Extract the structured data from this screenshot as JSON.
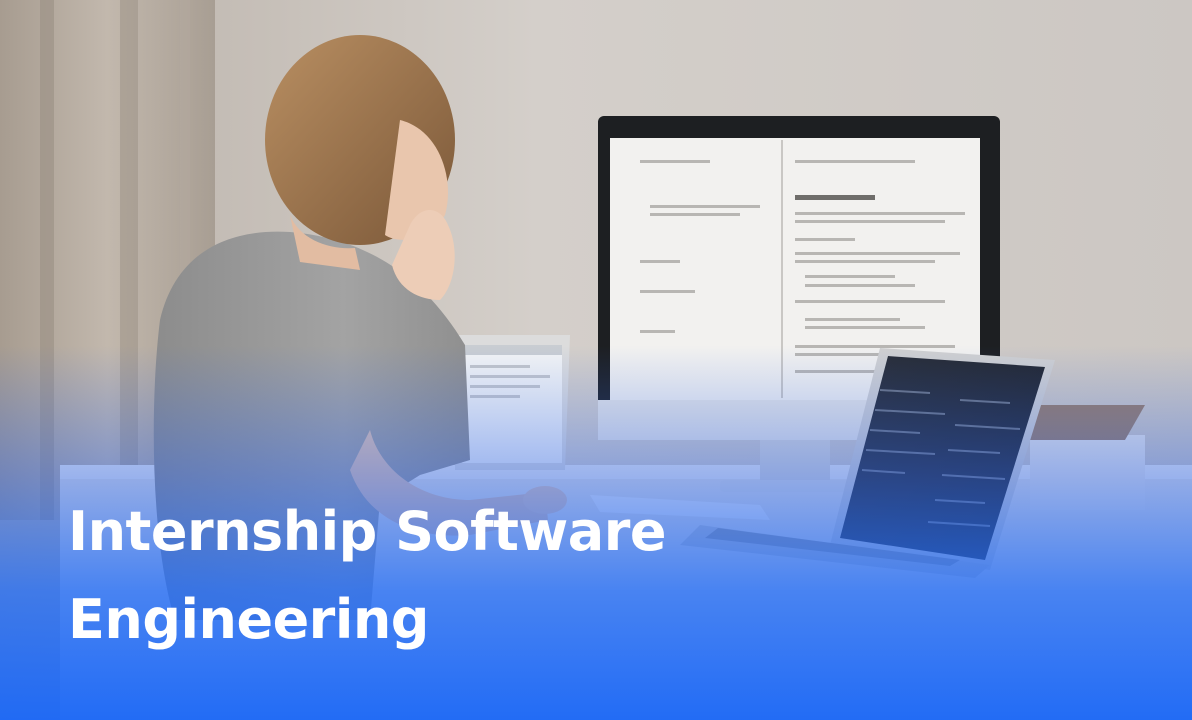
{
  "hero": {
    "title_line_1": "Internship Software",
    "title_line_2": "Engineering"
  }
}
